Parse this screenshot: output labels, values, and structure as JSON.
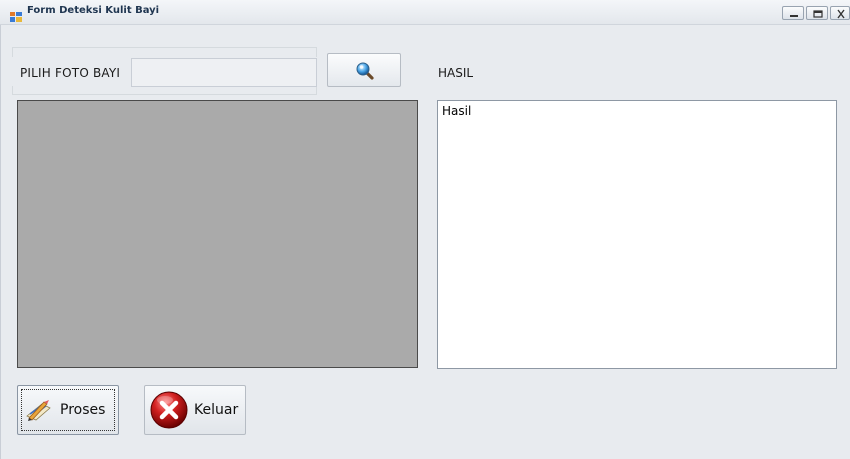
{
  "window": {
    "title": "Form Deteksi Kulit Bayi"
  },
  "form": {
    "pilih_label": "PILIH FOTO BAYI",
    "file_path_value": "",
    "hasil_label": "HASIL",
    "result_text": "Hasil"
  },
  "buttons": {
    "proses_label": "Proses",
    "keluar_label": "Keluar"
  },
  "icons": {
    "browse": "magnifier-icon",
    "proses": "pencil-paper-icon",
    "keluar": "red-x-circle-icon",
    "app": "form-icon"
  }
}
